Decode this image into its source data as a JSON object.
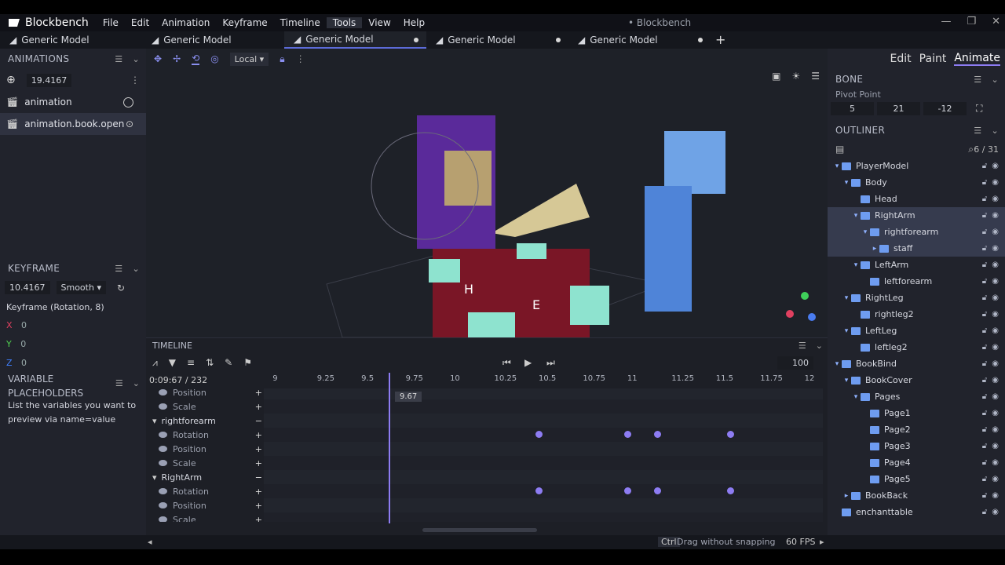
{
  "app": {
    "name": "Blockbench",
    "window_title": "• Blockbench"
  },
  "menu": [
    "File",
    "Edit",
    "Animation",
    "Keyframe",
    "Timeline",
    "Tools",
    "View",
    "Help"
  ],
  "tabs": [
    "Generic Model",
    "Generic Model",
    "Generic Model",
    "Generic Model",
    "Generic Model"
  ],
  "modes": {
    "edit": "Edit",
    "paint": "Paint",
    "animate": "Animate"
  },
  "animations": {
    "title": "ANIMATIONS",
    "length": "19.4167",
    "items": [
      "animation",
      "animation.book.open"
    ]
  },
  "keyframe": {
    "title": "KEYFRAME",
    "time": "10.4167",
    "interp": "Smooth",
    "label": "Keyframe (Rotation, 8)",
    "x": "0",
    "y": "0",
    "z": "0"
  },
  "variable": {
    "title": "VARIABLE PLACEHOLDERS",
    "hint": "List the variables you want to preview via name=value"
  },
  "viewport": {
    "space": "Local"
  },
  "bone": {
    "title": "BONE",
    "pivot_label": "Pivot Point",
    "x": "5",
    "y": "21",
    "z": "-12"
  },
  "outliner": {
    "title": "OUTLINER",
    "count": "6 / 31",
    "items": [
      "PlayerModel",
      "Body",
      "Head",
      "RightArm",
      "rightforearm",
      "staff",
      "LeftArm",
      "leftforearm",
      "RightLeg",
      "rightleg2",
      "LeftLeg",
      "leftleg2",
      "BookBind",
      "BookCover",
      "Pages",
      "Page1",
      "Page2",
      "Page3",
      "Page4",
      "Page5",
      "BookBack",
      "enchanttable"
    ]
  },
  "timeline": {
    "title": "TIMELINE",
    "time": "0:09:67",
    "frames": "232",
    "cursor": "9.67",
    "fps_value": "100",
    "ticks": [
      "9",
      "9.25",
      "9.5",
      "9.75",
      "10",
      "10.25",
      "10.5",
      "10.75",
      "11",
      "11.25",
      "11.5",
      "11.75",
      "12"
    ],
    "rows": [
      "Position",
      "Scale",
      "rightforearm",
      "Rotation",
      "Position",
      "Scale",
      "RightArm",
      "Rotation",
      "Position",
      "Scale"
    ]
  },
  "status": {
    "ctrl": "Ctrl",
    "hint": "Drag without snapping",
    "fps": "60 FPS"
  },
  "colors": {
    "accent": "#8d7cf2",
    "folder": "#6e9cf0"
  }
}
